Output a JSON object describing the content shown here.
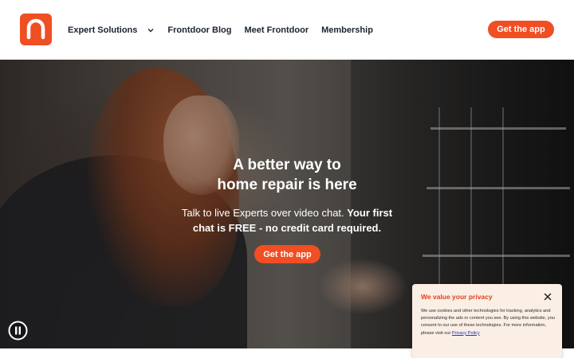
{
  "header": {
    "logo_icon": "frontdoor-logo-icon",
    "brand_color": "#f04e23",
    "nav": [
      {
        "label": "Expert Solutions",
        "has_dropdown": true
      },
      {
        "label": "Frontdoor Blog"
      },
      {
        "label": "Meet Frontdoor"
      },
      {
        "label": "Membership"
      }
    ],
    "cta_label": "Get the app"
  },
  "hero": {
    "title_line1": "A better way to",
    "title_line2": "home repair is here",
    "subtitle_plain": "Talk to live Experts over video chat. ",
    "subtitle_bold_1": "Your first",
    "subtitle_bold_2": "chat is FREE - no credit card required.",
    "cta_label": "Get the app",
    "pause_icon": "pause-icon"
  },
  "privacy": {
    "title": "We value your privacy",
    "body": "We use cookies and other technologies for tracking, analytics and personalizing the ads or content you see. By using this website, you consent to our use of these technologies. For more information, please visit our",
    "link_label": "Privacy Policy",
    "close_icon": "close-icon"
  }
}
